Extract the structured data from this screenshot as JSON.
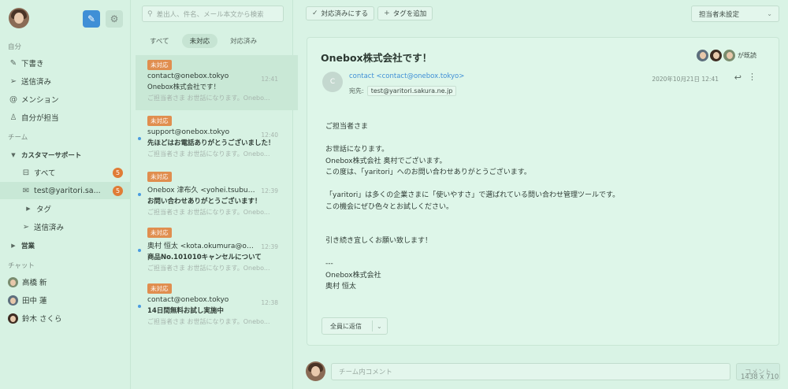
{
  "sidebar": {
    "section_self": "自分",
    "items_self": [
      {
        "label": "下書き",
        "icon": "pencil-icon"
      },
      {
        "label": "送信済み",
        "icon": "send-icon"
      },
      {
        "label": "メンション",
        "icon": "at-icon"
      },
      {
        "label": "自分が担当",
        "icon": "person-icon"
      }
    ],
    "section_team": "チーム",
    "team_group": "カスタマーサポート",
    "team_items": [
      {
        "label": "すべて",
        "badge": "5",
        "icon": "inbox-icon"
      },
      {
        "label": "test@yaritori.sa...",
        "badge": "5",
        "icon": "mail-icon"
      },
      {
        "label": "タグ",
        "icon": "caret-right-icon"
      },
      {
        "label": "送信済み",
        "icon": "send-icon"
      }
    ],
    "team_group_2": "営業",
    "section_chat": "チャット",
    "chat_users": [
      {
        "label": "高橋 新"
      },
      {
        "label": "田中 蓮"
      },
      {
        "label": "鈴木 さくら"
      }
    ]
  },
  "search": {
    "placeholder": "差出人、件名、メール本文から検索"
  },
  "list_tabs": [
    "すべて",
    "未対応",
    "対応済み"
  ],
  "messages": [
    {
      "tag": "未対応",
      "from": "contact@onebox.tokyo",
      "subject": "Onebox株式会社です！",
      "preview": "ご担当者さま お世話になります。Onebo...",
      "time": "12:41",
      "unread": false
    },
    {
      "tag": "未対応",
      "from": "support@onebox.tokyo",
      "subject": "先ほどはお電話ありがとうございました！",
      "preview": "ご担当者さま お世話になります。Onebo...",
      "time": "12:40",
      "unread": true
    },
    {
      "tag": "未対応",
      "from": "Onebox 津布久 <yohei.tsubuk...",
      "subject": "お問い合わせありがとうございます！",
      "preview": "ご担当者さま お世話になります。Onebo...",
      "time": "12:39",
      "unread": true
    },
    {
      "tag": "未対応",
      "from": "奥村 恒太 <kota.okumura@one...",
      "subject": "商品No.101010キャンセルについて",
      "preview": "ご担当者さま お世話になります。Onebo...",
      "time": "12:39",
      "unread": true
    },
    {
      "tag": "未対応",
      "from": "contact@onebox.tokyo",
      "subject": "14日間無料お試し実施中",
      "preview": "ご担当者さま お世話になります。Onebo...",
      "time": "12:38",
      "unread": true
    }
  ],
  "toolbar": {
    "mark_done": "対応済みにする",
    "add_tag": "タグを追加",
    "assignee": "担当者未設定"
  },
  "mail": {
    "subject": "Onebox株式会社です！",
    "viewers_text": "が既読",
    "sender_initial": "C",
    "sender": "contact <contact@onebox.tokyo>",
    "to_label": "宛先:",
    "to": "test@yaritori.sakura.ne.jp",
    "datetime": "2020年10月21日 12:41",
    "body": [
      "ご担当者さま",
      "",
      "お世話になります。",
      "Onebox株式会社 奥村でございます。",
      "この度は、「yaritori」へのお問い合わせありがとうございます。",
      "",
      "「yaritori」は多くの企業さまに「使いやすさ」で選ばれている問い合わせ管理ツールです。",
      "この機会にぜひ色々とお試しください。",
      "",
      "",
      "引き続き宜しくお願い致します！",
      "",
      "---",
      "Onebox株式会社",
      "奥村 恒太"
    ],
    "reply_all": "全員に返信"
  },
  "comment": {
    "placeholder": "チーム内コメント",
    "button": "コメント"
  },
  "dimensions_label": "1438 x 710"
}
